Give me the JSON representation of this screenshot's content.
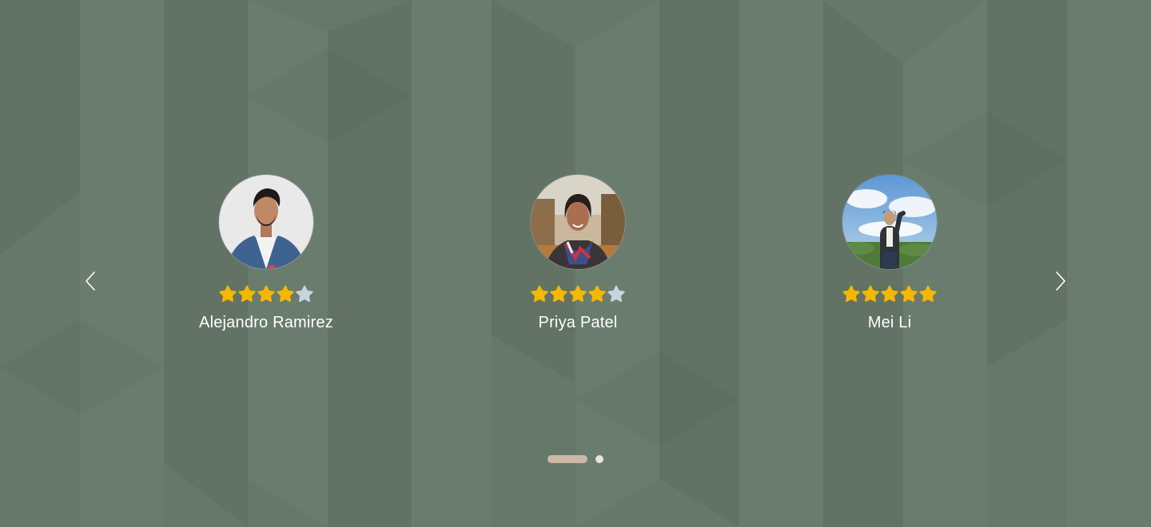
{
  "colors": {
    "background": "#66786a",
    "star_filled": "#f6b700",
    "star_empty": "#c8d3dc",
    "dot_active": "#cbb9a6",
    "dot_inactive": "#e4e4e4",
    "text": "#ffffff"
  },
  "carousel": {
    "prev_icon": "chevron-left-icon",
    "next_icon": "chevron-right-icon",
    "reviews": [
      {
        "name": "Alejandro Ramirez",
        "rating": 4,
        "max_rating": 5,
        "avatar": "man-denim-jacket-photo"
      },
      {
        "name": "Priya Patel",
        "rating": 4,
        "max_rating": 5,
        "avatar": "woman-scarf-autumn-photo"
      },
      {
        "name": "Mei Li",
        "rating": 5,
        "max_rating": 5,
        "avatar": "man-tea-field-sky-photo"
      }
    ],
    "pagination": {
      "current_page": 1,
      "total_pages": 2
    }
  }
}
